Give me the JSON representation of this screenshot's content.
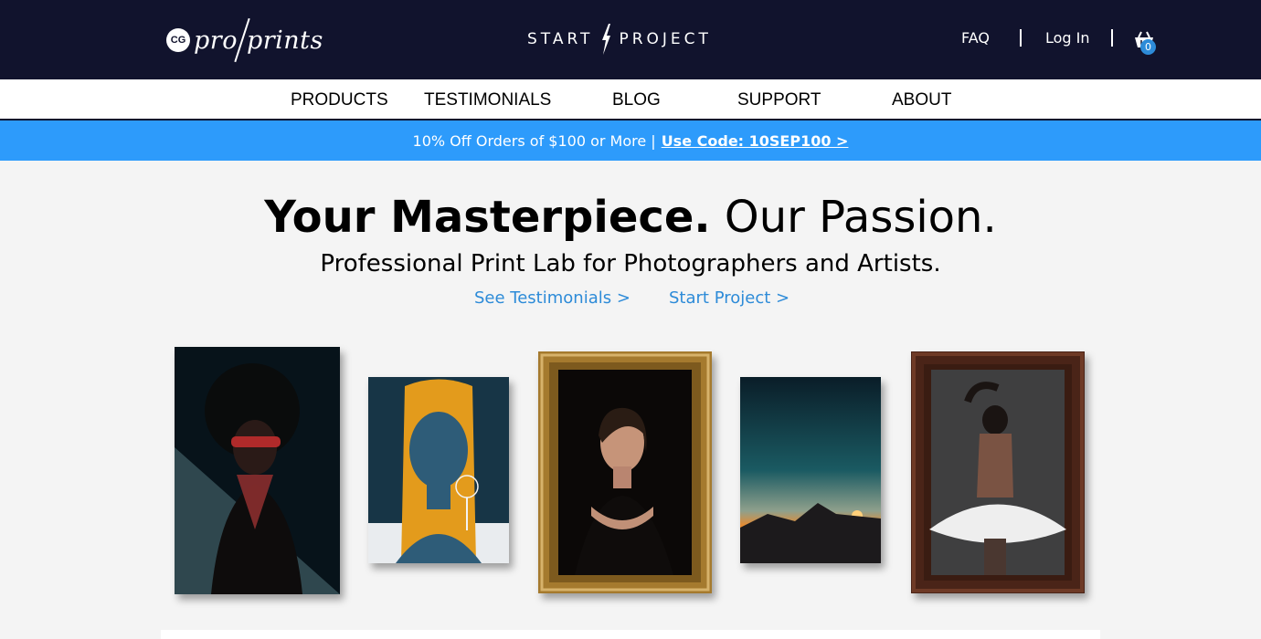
{
  "header": {
    "logo_badge": "CG",
    "logo_pro": "pro",
    "logo_prints": "prints",
    "start_word": "START",
    "project_word": "PROJECT",
    "faq_label": "FAQ",
    "login_label": "Log In",
    "cart_count": "0"
  },
  "nav": {
    "items": [
      {
        "label": "PRODUCTS"
      },
      {
        "label": "TESTIMONIALS"
      },
      {
        "label": "BLOG"
      },
      {
        "label": "SUPPORT"
      },
      {
        "label": "ABOUT"
      }
    ]
  },
  "promo": {
    "text": "10% Off Orders of $100 or More |",
    "link": "Use Code: 10SEP100 >"
  },
  "hero": {
    "title_bold": "Your Masterpiece.",
    "title_light": "Our Passion.",
    "subtitle": "Professional Print Lab for Photographers and Artists.",
    "link_testimonials": "See Testimonials >",
    "link_start": "Start Project >"
  },
  "colors": {
    "header_bg": "#11132d",
    "promo_bg": "#2d9bfb",
    "link_blue": "#2d8bd8"
  },
  "gallery": [
    {
      "name": "portrait-sunglasses-print"
    },
    {
      "name": "orange-hair-illustration-print"
    },
    {
      "name": "framed-woman-portrait"
    },
    {
      "name": "night-sky-landscape-print"
    },
    {
      "name": "framed-ballerina-print"
    }
  ]
}
